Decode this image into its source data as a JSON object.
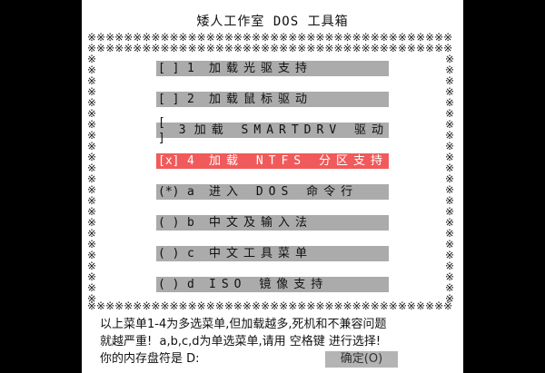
{
  "title": "矮人工作室 DOS 工具箱",
  "border_char": "※",
  "menu": [
    {
      "check": "[ ]",
      "key": "1",
      "label": "加载光驱支持",
      "selected": false
    },
    {
      "check": "[ ]",
      "key": "2",
      "label": "加载鼠标驱动",
      "selected": false
    },
    {
      "check": "[ ]",
      "key": "3",
      "label": "加载 SMARTDRV 驱动",
      "selected": false
    },
    {
      "check": "[x]",
      "key": "4",
      "label": "加载 NTFS 分区支持",
      "selected": true
    },
    {
      "check": "(*)",
      "key": "a",
      "label": "进入 DOS 命令行",
      "selected": false
    },
    {
      "check": "( )",
      "key": "b",
      "label": "中文及输入法",
      "selected": false
    },
    {
      "check": "( )",
      "key": "c",
      "label": "中文工具菜单",
      "selected": false
    },
    {
      "check": "( )",
      "key": "d",
      "label": "ISO 镜像支持",
      "selected": false
    }
  ],
  "help": {
    "line1": "以上菜单1-4为多选菜单,但加载越多,死机和不兼容问题",
    "line2": "就越严重!  a,b,c,d为单选菜单,请用 空格键 进行选择!",
    "line3": "你的内存盘符是 D:"
  },
  "ok_button": "确定(O)",
  "colors": {
    "selected": "#f15a5a",
    "item": "#ababab",
    "background": "#ffffff",
    "outer": "#000000"
  }
}
